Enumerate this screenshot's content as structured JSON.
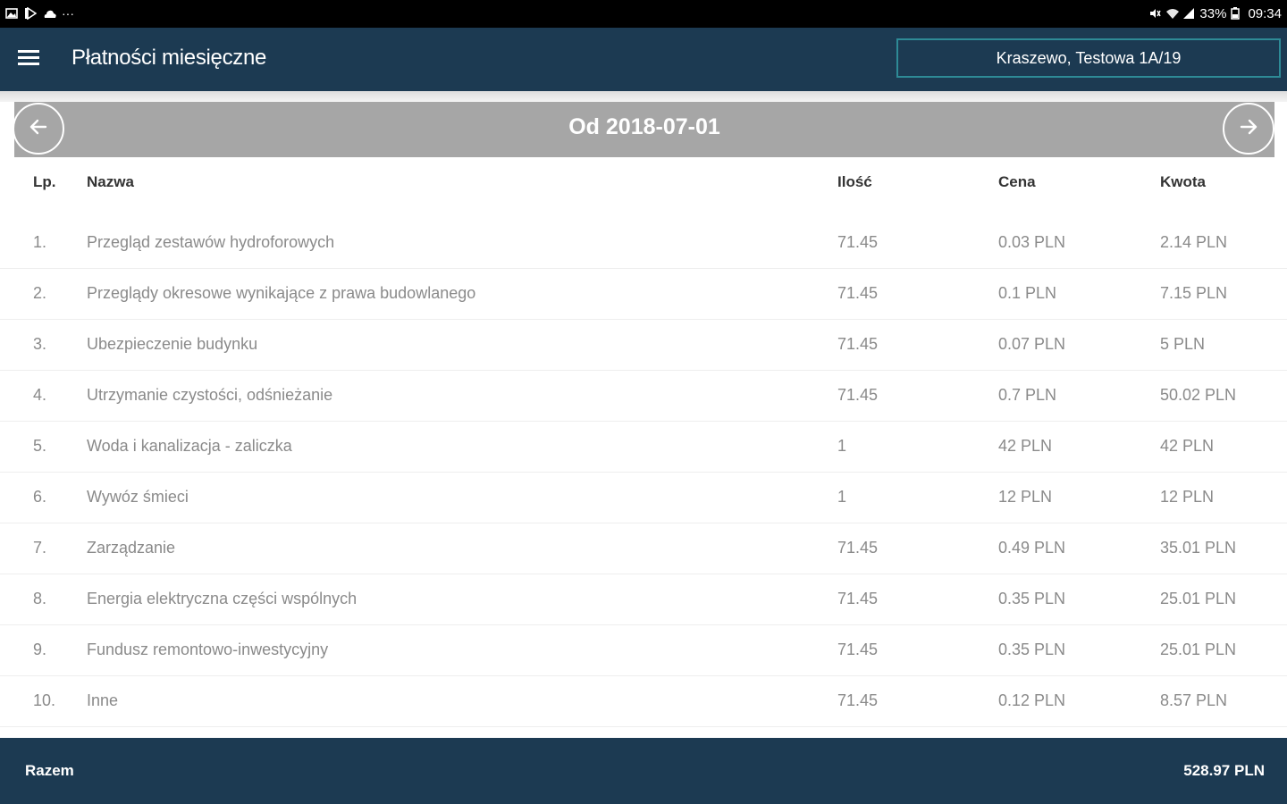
{
  "status_bar": {
    "left_icons": [
      "gallery-icon",
      "play-store-icon",
      "cloud-icon",
      "more-dots-icon"
    ],
    "more_text": "···",
    "battery": "33%",
    "time": "09:34"
  },
  "appbar": {
    "title": "Płatności miesięczne",
    "address": "Kraszewo, Testowa 1A/19"
  },
  "period": {
    "label": "Od 2018-07-01"
  },
  "table": {
    "headers": {
      "lp": "Lp.",
      "name": "Nazwa",
      "qty": "Ilość",
      "price": "Cena",
      "amount": "Kwota"
    },
    "rows": [
      {
        "lp": "1.",
        "name": "Przegląd zestawów hydroforowych",
        "qty": "71.45",
        "price": "0.03 PLN",
        "amount": "2.14 PLN"
      },
      {
        "lp": "2.",
        "name": "Przeglądy okresowe wynikające z prawa budowlanego",
        "qty": "71.45",
        "price": "0.1 PLN",
        "amount": "7.15 PLN"
      },
      {
        "lp": "3.",
        "name": "Ubezpieczenie budynku",
        "qty": "71.45",
        "price": "0.07 PLN",
        "amount": "5 PLN"
      },
      {
        "lp": "4.",
        "name": "Utrzymanie czystości, odśnieżanie",
        "qty": "71.45",
        "price": "0.7 PLN",
        "amount": "50.02 PLN"
      },
      {
        "lp": "5.",
        "name": "Woda i kanalizacja - zaliczka",
        "qty": "1",
        "price": "42 PLN",
        "amount": "42 PLN"
      },
      {
        "lp": "6.",
        "name": "Wywóz śmieci",
        "qty": "1",
        "price": "12 PLN",
        "amount": "12 PLN"
      },
      {
        "lp": "7.",
        "name": "Zarządzanie",
        "qty": "71.45",
        "price": "0.49 PLN",
        "amount": "35.01 PLN"
      },
      {
        "lp": "8.",
        "name": "Energia elektryczna części wspólnych",
        "qty": "71.45",
        "price": "0.35 PLN",
        "amount": "25.01 PLN"
      },
      {
        "lp": "9.",
        "name": "Fundusz remontowo-inwestycyjny",
        "qty": "71.45",
        "price": "0.35 PLN",
        "amount": "25.01 PLN"
      },
      {
        "lp": "10.",
        "name": "Inne",
        "qty": "71.45",
        "price": "0.12 PLN",
        "amount": "8.57 PLN"
      }
    ]
  },
  "footer": {
    "label": "Razem",
    "total": "528.97 PLN"
  },
  "colors": {
    "appbar": "#1c3a52",
    "address_border": "#2e8a96",
    "datebar": "#a6a6a6"
  }
}
